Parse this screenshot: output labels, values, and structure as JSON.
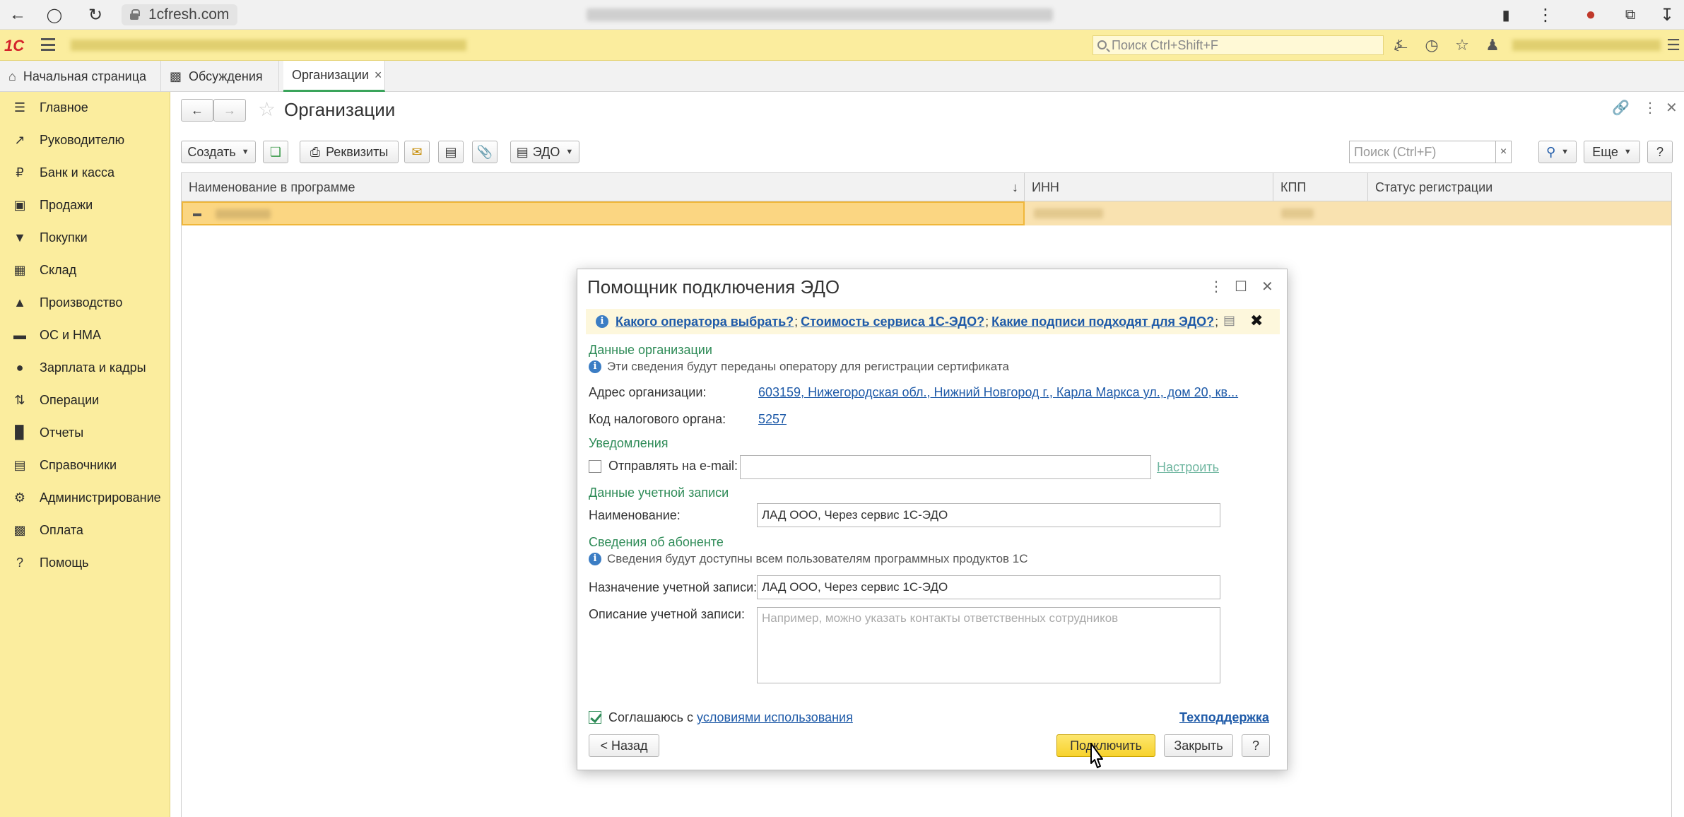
{
  "browser": {
    "url": "1cfresh.com"
  },
  "header": {
    "logo": "1С",
    "search_placeholder": "Поиск Ctrl+Shift+F"
  },
  "tabs": [
    {
      "label": "Начальная страница"
    },
    {
      "label": "Обсуждения"
    },
    {
      "label": "Организации"
    }
  ],
  "sidebar": {
    "items": [
      {
        "label": "Главное",
        "icon": "menu-icon"
      },
      {
        "label": "Руководителю",
        "icon": "trend-icon"
      },
      {
        "label": "Банк и касса",
        "icon": "ruble-icon"
      },
      {
        "label": "Продажи",
        "icon": "bag-icon"
      },
      {
        "label": "Покупки",
        "icon": "cart-icon"
      },
      {
        "label": "Склад",
        "icon": "grid-icon"
      },
      {
        "label": "Производство",
        "icon": "factory-icon"
      },
      {
        "label": "ОС и НМА",
        "icon": "truck-icon"
      },
      {
        "label": "Зарплата и кадры",
        "icon": "person-icon"
      },
      {
        "label": "Операции",
        "icon": "operations-icon"
      },
      {
        "label": "Отчеты",
        "icon": "bar-chart-icon"
      },
      {
        "label": "Справочники",
        "icon": "books-icon"
      },
      {
        "label": "Администрирование",
        "icon": "gear-icon"
      },
      {
        "label": "Оплата",
        "icon": "wallet-icon"
      },
      {
        "label": "Помощь",
        "icon": "question-icon"
      }
    ]
  },
  "page": {
    "title": "Организации",
    "toolbar": {
      "create": "Создать",
      "requisites": "Реквизиты",
      "edo": "ЭДО",
      "search_placeholder": "Поиск (Ctrl+F)",
      "more": "Еще",
      "help": "?"
    },
    "table": {
      "columns": [
        "Наименование в программе",
        "ИНН",
        "КПП",
        "Статус регистрации"
      ]
    }
  },
  "dialog": {
    "title": "Помощник подключения ЭДО",
    "info_links": [
      "Какого оператора выбрать?",
      "Стоимость сервиса 1С-ЭДО?",
      "Какие подписи подходят для ЭДО?"
    ],
    "org_section": "Данные организации",
    "org_hint": "Эти сведения будут переданы оператору для регистрации сертификата",
    "address_label": "Адрес организации:",
    "address_value": "603159, Нижегородская обл., Нижний Новгород г., Карла Маркса ул., дом 20, кв...",
    "tax_label": "Код налогового органа:",
    "tax_value": "5257",
    "notify_section": "Уведомления",
    "email_label": "Отправлять на e-mail:",
    "email_value": "",
    "configure": "Настроить",
    "account_section": "Данные учетной записи",
    "name_label": "Наименование:",
    "name_value": "ЛАД ООО, Через сервис 1С-ЭДО",
    "subscriber_section": "Сведения об абоненте",
    "subscriber_hint": "Сведения будут доступны всем пользователям программных продуктов 1С",
    "purpose_label": "Назначение учетной записи:",
    "purpose_value": "ЛАД ООО, Через сервис 1С-ЭДО",
    "desc_label": "Описание учетной записи:",
    "desc_placeholder": "Например, можно указать контакты ответственных сотрудников",
    "agree_text": "Соглашаюсь с ",
    "agree_link": "условиями использования",
    "support": "Техподдержка",
    "back": "< Назад",
    "connect": "Подключить",
    "close": "Закрыть",
    "help": "?"
  }
}
